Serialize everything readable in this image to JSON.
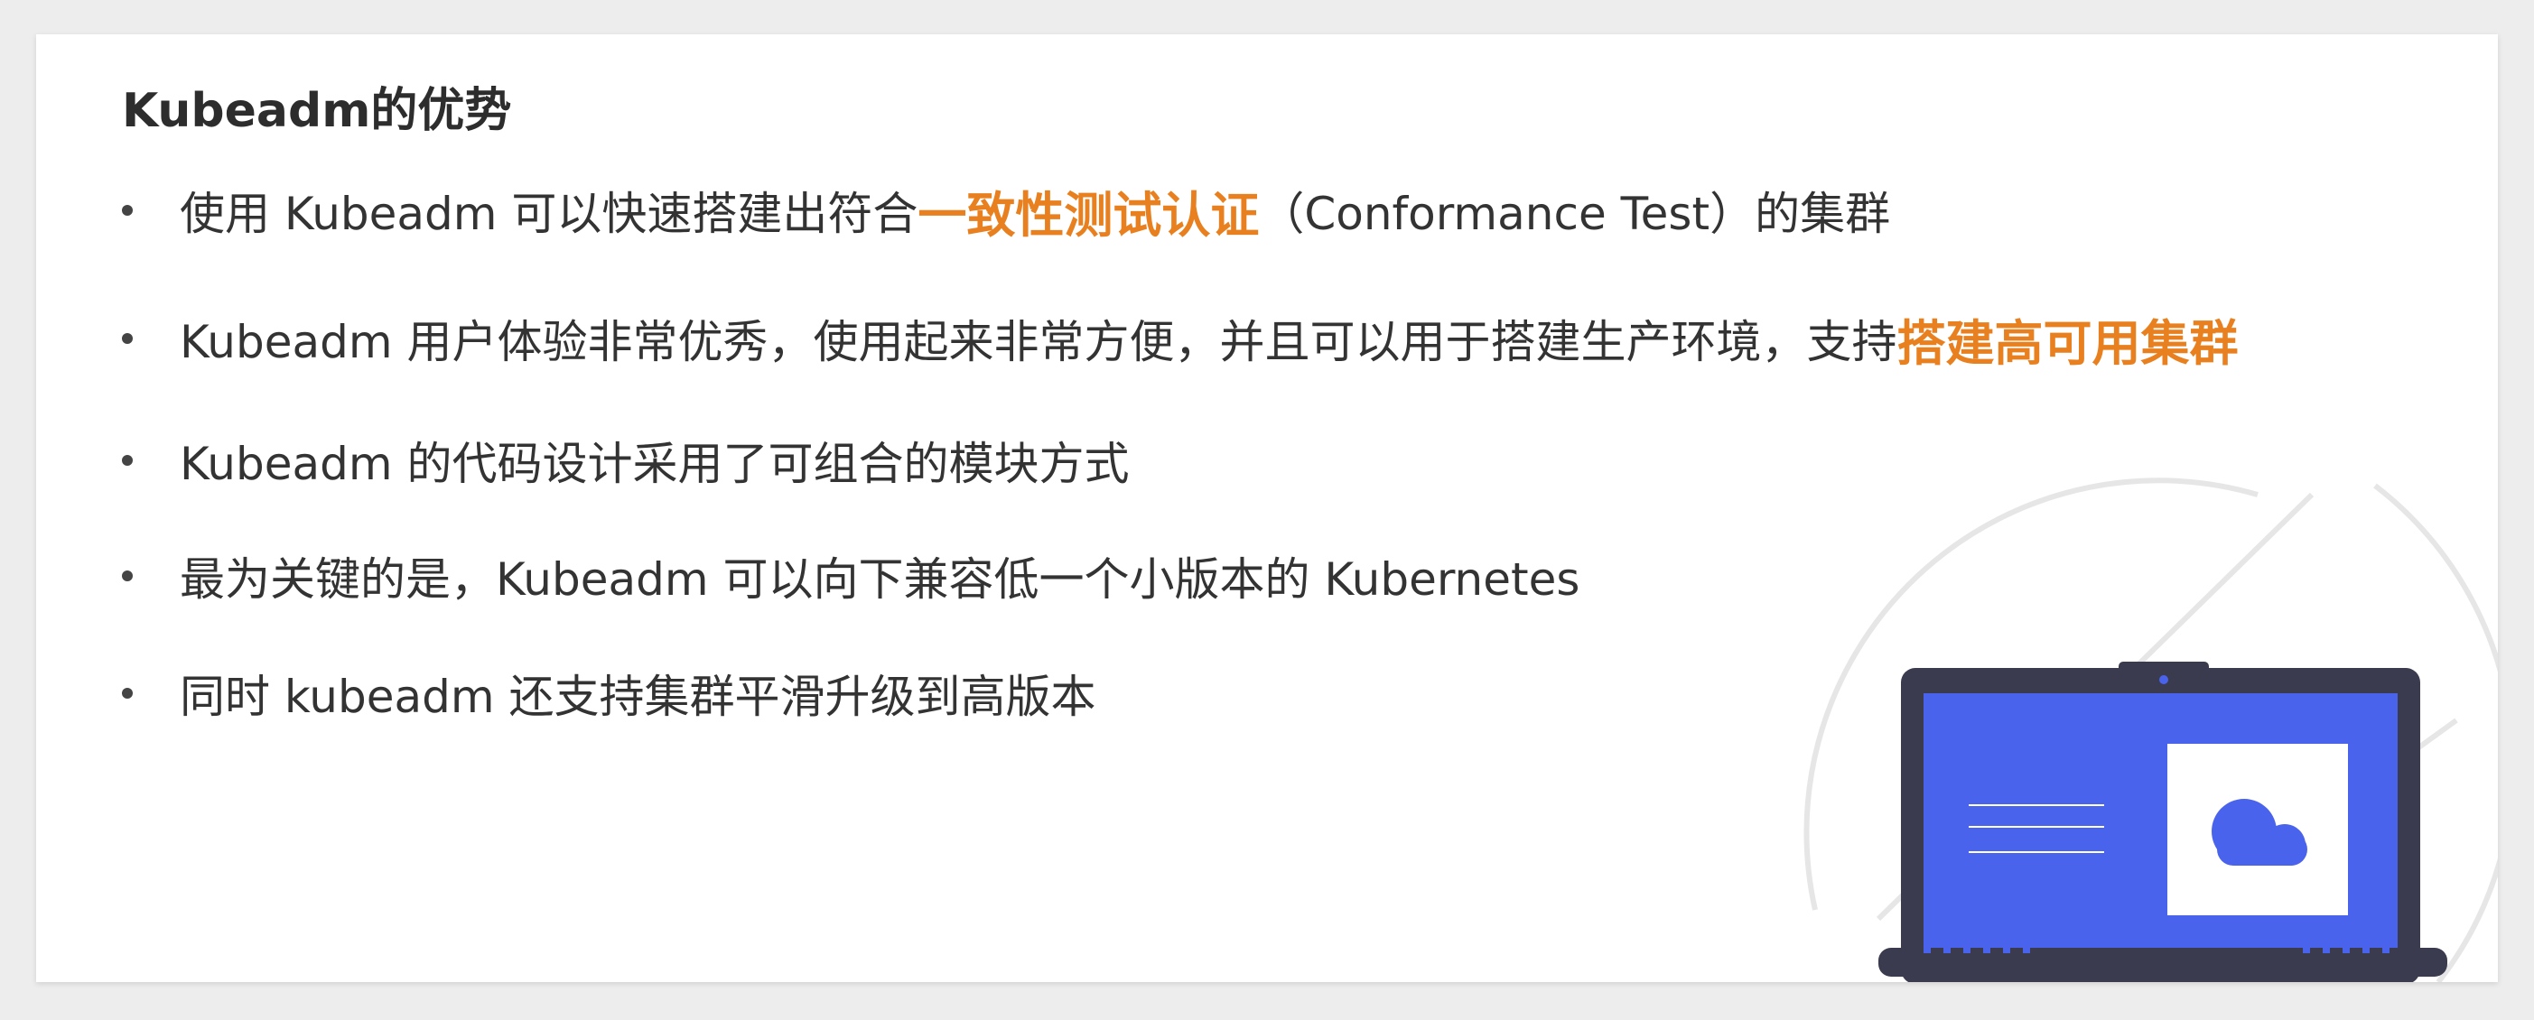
{
  "slide": {
    "title": "Kubeadm的优势",
    "bullets": [
      {
        "before": "使用 Kubeadm 可以快速搭建出符合",
        "highlight": "一致性测试认证",
        "after": "（Conformance Test）的集群"
      },
      {
        "before": "Kubeadm 用户体验非常优秀，使用起来非常方便，并且可以用于搭建生产环境，支持",
        "highlight": "搭建高可用集群",
        "after": ""
      },
      {
        "text": "Kubeadm 的代码设计采用了可组合的模块方式"
      },
      {
        "text": "最为关键的是，Kubeadm 可以向下兼容低一个小版本的 Kubernetes"
      },
      {
        "text": "同时 kubeadm 还支持集群平滑升级到高版本"
      }
    ]
  },
  "colors": {
    "highlight": "#e8801f",
    "text": "#333333",
    "laptop_screen": "#4a63ec",
    "laptop_frame": "#3b3b4f"
  },
  "illustration": {
    "icons": [
      "laptop-icon",
      "cloud-icon"
    ]
  }
}
